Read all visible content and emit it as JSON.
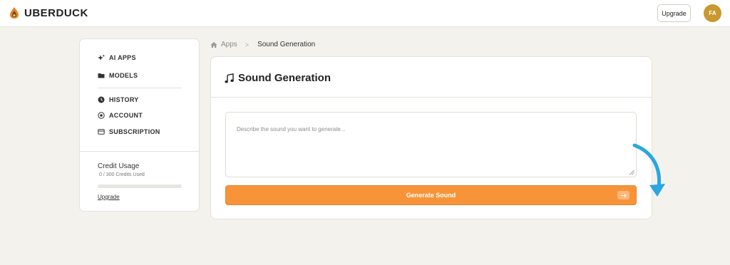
{
  "header": {
    "brand_name": "UBERDUCK",
    "upgrade_label": "Upgrade",
    "avatar_initials": "FA"
  },
  "sidebar": {
    "items": [
      {
        "label": "AI APPS",
        "icon": "sparkle-icon"
      },
      {
        "label": "MODELS",
        "icon": "folder-icon"
      },
      {
        "label": "HISTORY",
        "icon": "clock-icon"
      },
      {
        "label": "ACCOUNT",
        "icon": "account-icon"
      },
      {
        "label": "SUBSCRIPTION",
        "icon": "card-icon"
      }
    ],
    "credit": {
      "title": "Credit Usage",
      "used_text": "0 / 300 Credits Used",
      "used_fraction": 0,
      "upgrade_link": "Upgrade"
    }
  },
  "breadcrumb": {
    "home": "Apps",
    "separator": ">",
    "current": "Sound Generation"
  },
  "main": {
    "title": "Sound Generation",
    "title_icon": "music-note-icon",
    "prompt_placeholder": "Describe the sound you want to generate...",
    "prompt_value": "",
    "generate_label": "Generate Sound"
  },
  "colors": {
    "accent": "#f7943a",
    "background": "#f3f2ec",
    "avatar": "#c9982e",
    "annotation": "#2aa6e0"
  }
}
